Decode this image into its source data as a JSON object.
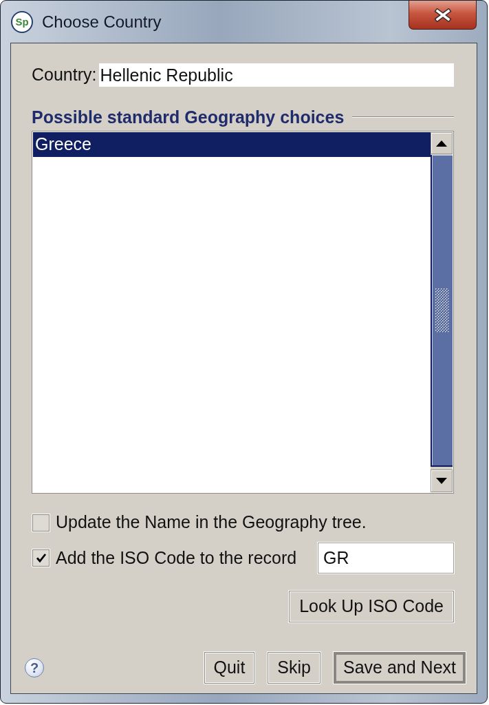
{
  "window": {
    "icon_text": "Sp",
    "title": "Choose Country"
  },
  "country": {
    "label": "Country:",
    "value": "Hellenic Republic"
  },
  "choices": {
    "title": "Possible standard Geography choices",
    "items": [
      {
        "label": "Greece",
        "selected": true
      }
    ]
  },
  "options": [
    {
      "kind": "checkbox",
      "label": "Update the Name in the Geography tree.",
      "checked": false
    },
    {
      "kind": "checkbox_field",
      "label": "Add the ISO Code to the record",
      "checked": true,
      "value": "GR"
    }
  ],
  "lookup_button": {
    "label": "Look Up ISO Code"
  },
  "help_button": {
    "label": "?"
  },
  "buttons": [
    {
      "label": "Quit",
      "default": false
    },
    {
      "label": "Skip",
      "default": false
    },
    {
      "label": "Save and Next",
      "default": true
    }
  ]
}
